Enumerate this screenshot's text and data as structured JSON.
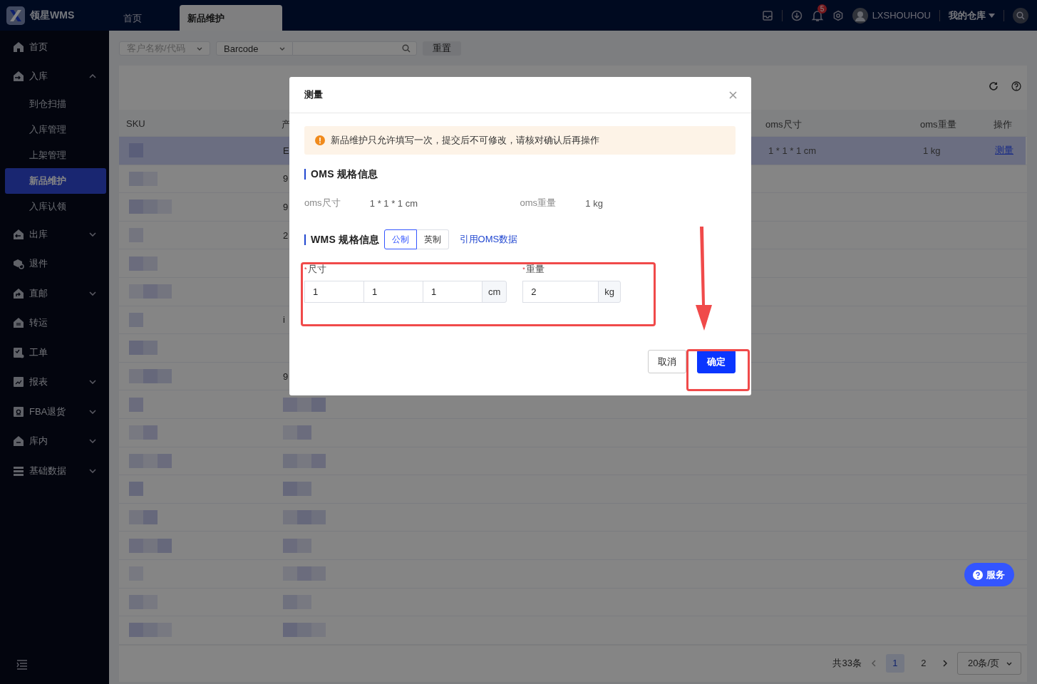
{
  "header": {
    "app_name": "领星WMS",
    "tabs": [
      {
        "label": "首页",
        "selected": false
      },
      {
        "label": "新品维护",
        "selected": true
      }
    ],
    "notification_count": "5",
    "username": "LXSHOUHOU",
    "warehouse_menu": "我的仓库"
  },
  "sidebar": {
    "items": [
      {
        "label": "首页",
        "kind": "home"
      },
      {
        "label": "入库",
        "kind": "inbound",
        "expanded": true,
        "children": [
          {
            "label": "到仓扫描",
            "selected": false
          },
          {
            "label": "入库管理",
            "selected": false
          },
          {
            "label": "上架管理",
            "selected": false
          },
          {
            "label": "新品维护",
            "selected": true
          },
          {
            "label": "入库认领",
            "selected": false
          }
        ]
      },
      {
        "label": "出库",
        "kind": "outbound",
        "expanded": false
      },
      {
        "label": "退件",
        "kind": "return"
      },
      {
        "label": "直邮",
        "kind": "direct",
        "expanded": false
      },
      {
        "label": "转运",
        "kind": "transfer"
      },
      {
        "label": "工单",
        "kind": "ticket"
      },
      {
        "label": "报表",
        "kind": "report",
        "expanded": false
      },
      {
        "label": "FBA退货",
        "kind": "amazon",
        "expanded": false
      },
      {
        "label": "库内",
        "kind": "stock",
        "expanded": false
      },
      {
        "label": "基础数据",
        "kind": "grid",
        "expanded": false
      }
    ]
  },
  "filters": {
    "customer_select": {
      "placeholder": "客户名称/代码"
    },
    "type_select": {
      "value": "Barcode"
    },
    "reset_button": "重置"
  },
  "table": {
    "columns": [
      {
        "label": "SKU"
      },
      {
        "label": "产"
      },
      {
        "label": "oms尺寸"
      },
      {
        "label": "oms重量"
      },
      {
        "label": "操作"
      }
    ],
    "rows": [
      {
        "selected": true,
        "product": "E",
        "oms_size": "1 * 1 * 1 cm",
        "oms_weight": "1 kg",
        "action": "测量"
      },
      {
        "selected": false,
        "product": "9"
      },
      {
        "selected": false,
        "product": "9"
      },
      {
        "selected": false,
        "product": "2"
      },
      {
        "selected": false
      },
      {
        "selected": false
      },
      {
        "selected": false,
        "product": "i"
      },
      {
        "selected": false
      },
      {
        "selected": false,
        "product": "9"
      },
      {
        "selected": false
      },
      {
        "selected": false
      },
      {
        "selected": false
      },
      {
        "selected": false
      },
      {
        "selected": false
      },
      {
        "selected": false
      },
      {
        "selected": false
      },
      {
        "selected": false
      },
      {
        "selected": false
      }
    ]
  },
  "pagination": {
    "total": "共33条",
    "pages": [
      {
        "label": "1",
        "selected": true
      },
      {
        "label": "2",
        "selected": false
      }
    ],
    "page_size": "20条/页"
  },
  "service_button": "服务",
  "dialog": {
    "title": "测量",
    "alert": "新品维护只允许填写一次，提交后不可修改，请核对确认后再操作",
    "oms_section": {
      "title": "OMS 规格信息",
      "size_label": "oms尺寸",
      "size_value": "1 * 1 * 1 cm",
      "weight_label": "oms重量",
      "weight_value": "1 kg"
    },
    "wms_section": {
      "title": "WMS 规格信息",
      "units": [
        {
          "label": "公制",
          "selected": true
        },
        {
          "label": "英制",
          "selected": false
        }
      ],
      "link": "引用OMS数据"
    },
    "fields": [
      {
        "kind": "size",
        "label": "尺寸",
        "required_mark": "*",
        "values": [
          "1",
          "1",
          "1"
        ],
        "unit": "cm"
      },
      {
        "kind": "weight",
        "label": "重量",
        "required_mark": "*",
        "values": [
          "2"
        ],
        "unit": "kg"
      }
    ],
    "buttons": [
      {
        "label": "取消",
        "kind": "default"
      },
      {
        "label": "确定",
        "kind": "primary"
      }
    ]
  }
}
